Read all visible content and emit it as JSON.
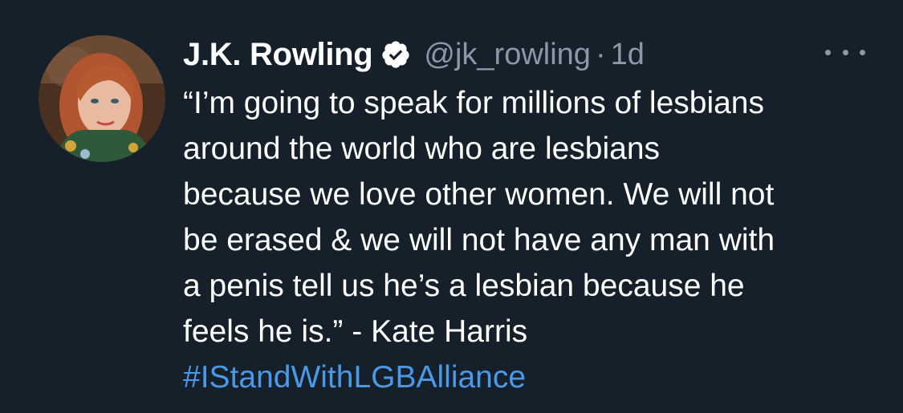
{
  "tweet": {
    "author": {
      "display_name": "J.K. Rowling",
      "verified": true,
      "handle": "@jk_rowling",
      "separator": "·",
      "time": "1d"
    },
    "text_lines": [
      "“I’m going to speak for millions of lesbians",
      "around the world who are lesbians",
      "because we love other women. We will not",
      "be erased & we will not have any man with",
      "a penis tell us he’s a lesbian because he",
      "feels he is.” - Kate Harris"
    ],
    "hashtag": "#IStandWithLGBAlliance"
  },
  "icons": {
    "verified": "verified-badge-icon",
    "more": "more-options-icon"
  },
  "colors": {
    "background": "#15202b",
    "text": "#ffffff",
    "secondary_text": "#8b98a5",
    "link": "#4a99e9"
  }
}
